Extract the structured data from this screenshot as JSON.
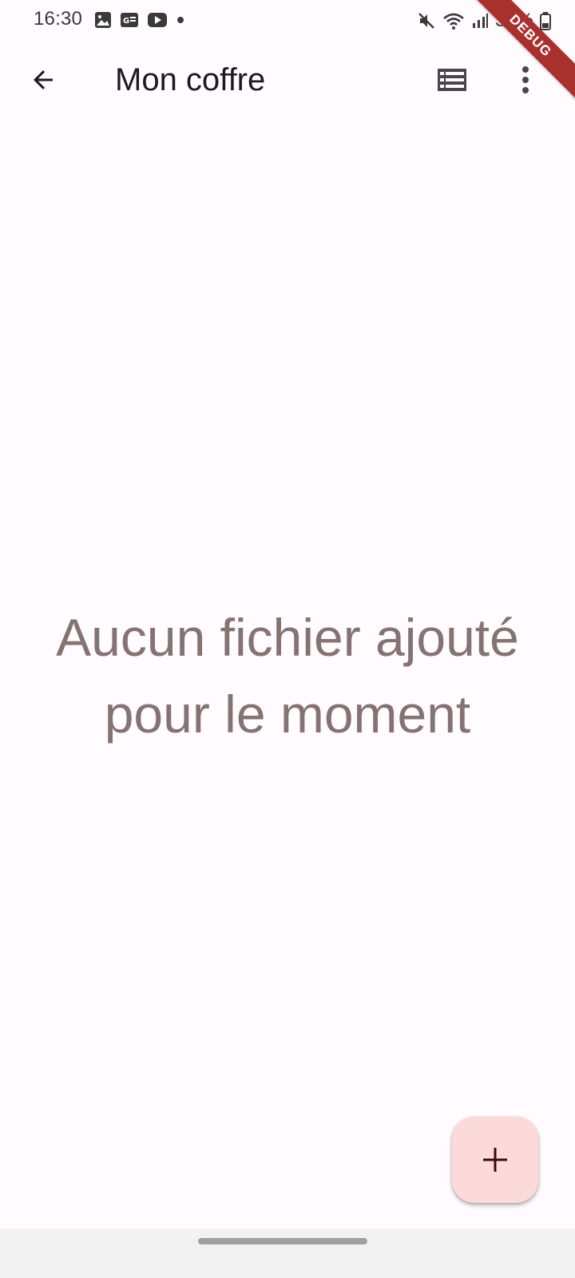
{
  "status_bar": {
    "time": "16:30",
    "battery_text": "32%",
    "left_icons": [
      "image-icon",
      "news-icon",
      "youtube-icon",
      "dot-icon"
    ],
    "right_icons": [
      "mute-icon",
      "wifi-icon",
      "signal-icon",
      "battery-icon"
    ]
  },
  "debug_banner": "DEBUG",
  "app_bar": {
    "title": "Mon coffre",
    "back_icon": "arrow-back-icon",
    "view_icon": "list-view-icon",
    "more_icon": "more-vert-icon"
  },
  "empty_state": {
    "message": "Aucun fichier ajouté pour le moment"
  },
  "fab": {
    "icon": "add-icon"
  },
  "colors": {
    "background": "#fffbfe",
    "muted_text": "#857372",
    "fab_background": "#fddada",
    "debug_ribbon": "#a8312e"
  }
}
